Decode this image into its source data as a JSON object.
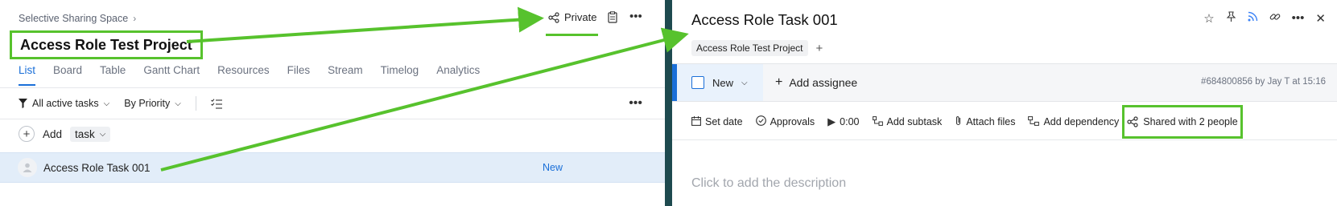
{
  "left": {
    "breadcrumb": "Selective Sharing Space",
    "project_title": "Access Role Test Project",
    "privacy_label": "Private",
    "tabs": [
      {
        "label": "List"
      },
      {
        "label": "Board"
      },
      {
        "label": "Table"
      },
      {
        "label": "Gantt Chart"
      },
      {
        "label": "Resources"
      },
      {
        "label": "Files"
      },
      {
        "label": "Stream"
      },
      {
        "label": "Timelog"
      },
      {
        "label": "Analytics"
      }
    ],
    "toolbar": {
      "filter_label": "All active tasks",
      "sort_label": "By Priority"
    },
    "add_row": {
      "add_label": "Add",
      "type_label": "task"
    },
    "task": {
      "name": "Access Role Task 001",
      "status": "New"
    }
  },
  "right": {
    "task_title": "Access Role Task 001",
    "project_tag": "Access Role Test Project",
    "status": "New",
    "add_assignee": "Add assignee",
    "meta": "#684800856 by Jay T at 15:16",
    "actions": {
      "set_date": "Set date",
      "approvals": "Approvals",
      "timer": "0:00",
      "add_subtask": "Add subtask",
      "attach_files": "Attach files",
      "add_dependency": "Add dependency",
      "shared": "Shared with 2 people"
    },
    "description_placeholder": "Click to add the description"
  },
  "colors": {
    "accent_blue": "#1a6fd8",
    "highlight_green": "#57c22d",
    "divider": "#1e4a4f"
  }
}
